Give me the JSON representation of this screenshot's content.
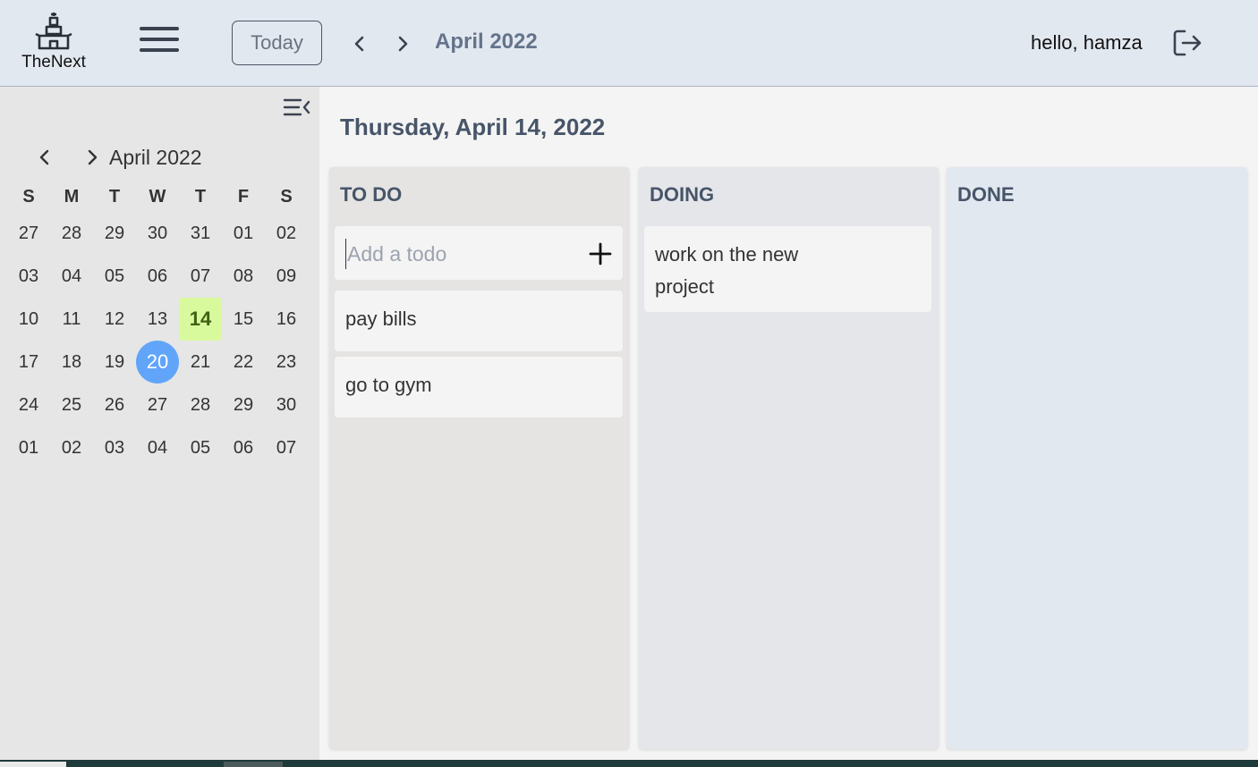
{
  "header": {
    "logo_text": "TheNext",
    "today_label": "Today",
    "month_label": "April 2022",
    "greeting": "hello, hamza",
    "icons": [
      "castle-logo-icon",
      "hamburger-menu-icon",
      "chevron-left-icon",
      "chevron-right-icon",
      "logout-icon"
    ]
  },
  "sidebar": {
    "month_label": "April 2022",
    "weekdays": [
      "S",
      "M",
      "T",
      "W",
      "T",
      "F",
      "S"
    ],
    "days": [
      "27",
      "28",
      "29",
      "30",
      "31",
      "01",
      "02",
      "03",
      "04",
      "05",
      "06",
      "07",
      "08",
      "09",
      "10",
      "11",
      "12",
      "13",
      "14",
      "15",
      "16",
      "17",
      "18",
      "19",
      "20",
      "21",
      "22",
      "23",
      "24",
      "25",
      "26",
      "27",
      "28",
      "29",
      "30",
      "01",
      "02",
      "03",
      "04",
      "05",
      "06",
      "07"
    ],
    "selected_day": "14",
    "today_day": "20",
    "colors": {
      "selected_bg": "#d9f99d",
      "today_bg": "#60a5fa"
    }
  },
  "main": {
    "date_heading": "Thursday, April 14, 2022",
    "columns": {
      "todo": {
        "title": "TO DO",
        "add_placeholder": "Add a todo",
        "cards": [
          "pay bills",
          "go to gym"
        ]
      },
      "doing": {
        "title": "DOING",
        "cards": [
          "work on the new project"
        ]
      },
      "done": {
        "title": "DONE",
        "cards": []
      }
    }
  }
}
